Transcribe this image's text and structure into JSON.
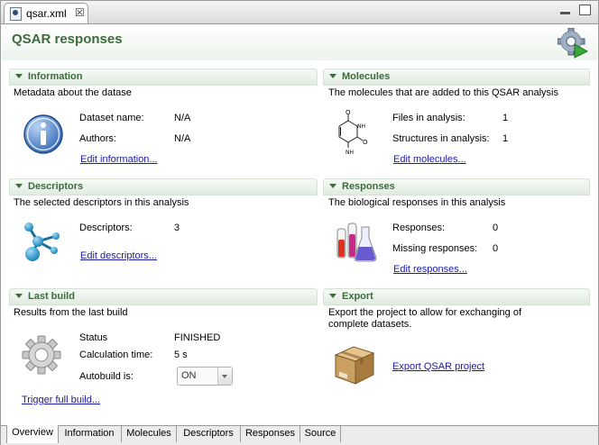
{
  "tab": {
    "title": "qsar.xml",
    "close": "☒"
  },
  "header": {
    "title": "QSAR responses"
  },
  "sections": {
    "information": {
      "title": "Information",
      "description": "Metadata about the datase",
      "fields": [
        {
          "label": "Dataset name:",
          "value": "N/A"
        },
        {
          "label": "Authors:",
          "value": "N/A"
        }
      ],
      "link": "Edit information..."
    },
    "molecules": {
      "title": "Molecules",
      "description": "The molecules that are added to this QSAR analysis",
      "fields": [
        {
          "label": "Files in analysis:",
          "value": "1"
        },
        {
          "label": "Structures in analysis:",
          "value": "1"
        }
      ],
      "link": "Edit molecules..."
    },
    "descriptors": {
      "title": "Descriptors",
      "description": "The selected descriptors in this analysis",
      "fields": [
        {
          "label": "Descriptors:",
          "value": "3"
        }
      ],
      "link": "Edit descriptors..."
    },
    "responses": {
      "title": "Responses",
      "description": "The biological responses in this analysis",
      "fields": [
        {
          "label": "Responses:",
          "value": "0"
        },
        {
          "label": "Missing responses:",
          "value": "0"
        }
      ],
      "link": "Edit responses..."
    },
    "last_build": {
      "title": "Last build",
      "description": "Results from the last build",
      "fields": [
        {
          "label": "Status",
          "value": "FINISHED"
        },
        {
          "label": "Calculation time:",
          "value": "5 s"
        },
        {
          "label": "Autobuild is:",
          "value": "ON"
        }
      ],
      "link": "Trigger full build..."
    },
    "export": {
      "title": "Export",
      "description_line1": "Export the project to allow for exchanging of",
      "description_line2": "complete datasets.",
      "link": "Export QSAR project"
    }
  },
  "bottom_tabs": [
    "Overview",
    "Information",
    "Molecules",
    "Descriptors",
    "Responses",
    "Source"
  ],
  "colors": {
    "accent": "#3d6b3d",
    "link": "#1a1aa6"
  },
  "icons": {
    "information": "info-icon",
    "molecules": "molecule-structure-icon",
    "descriptors": "descriptor-molecule-icon",
    "responses": "lab-flasks-icon",
    "last_build": "gear-icon",
    "export": "package-box-icon",
    "header": "gear-run-icon"
  }
}
